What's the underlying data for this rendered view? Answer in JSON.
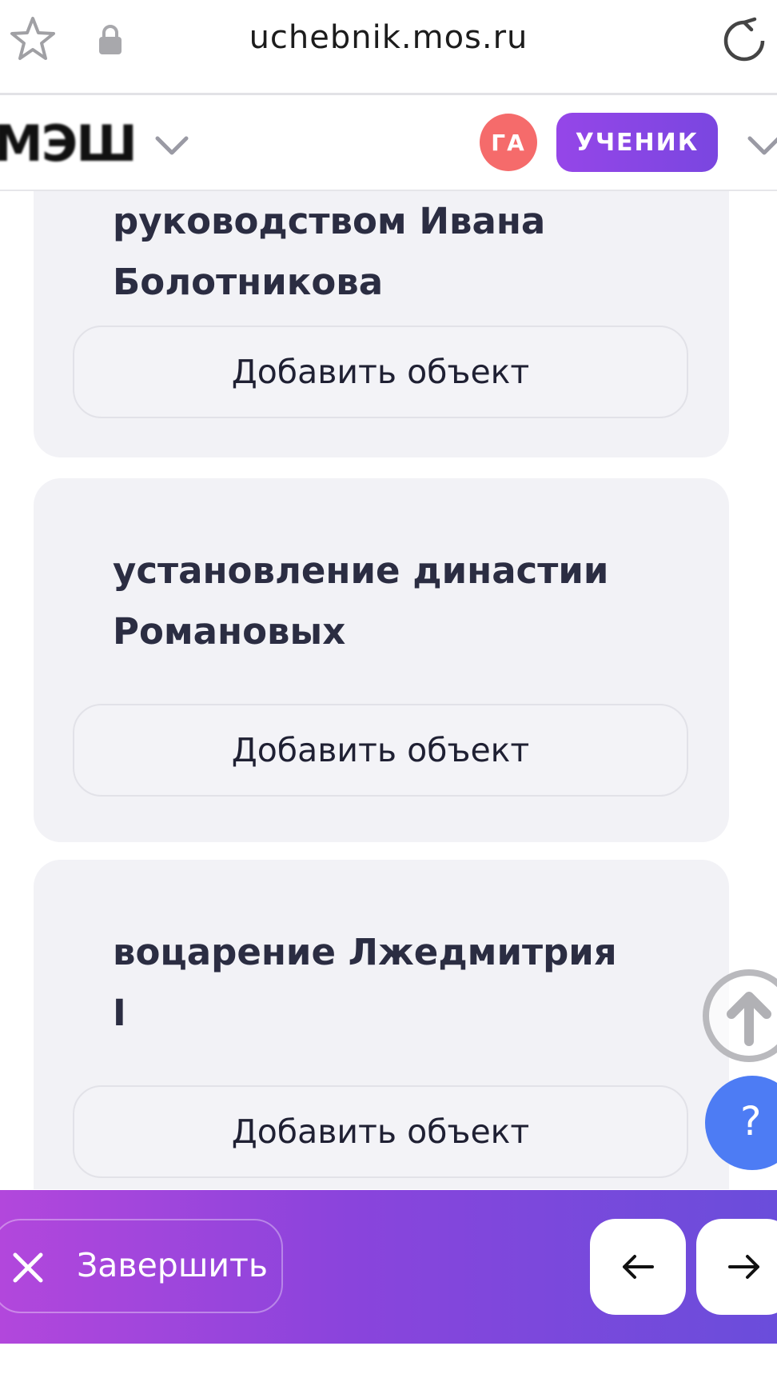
{
  "browser": {
    "url": "uchebnik.mos.ru",
    "icons": [
      "star-icon",
      "lock-icon",
      "reload-icon"
    ]
  },
  "header": {
    "logo": "МЭШ",
    "avatar_initials": "ГА",
    "role_label": "УЧЕНИК",
    "accent_color": "#8a46e6",
    "avatar_color": "#f56b6b"
  },
  "cards": [
    {
      "title_line1": "руководством Ивана",
      "title_line2": "Болотникова",
      "button": "Добавить объект"
    },
    {
      "title_line1": "установление династии",
      "title_line2": "Романовых",
      "button": "Добавить объект"
    },
    {
      "title_line1": "воцарение Лжедмитрия",
      "title_line2": "I",
      "button": "Добавить объект"
    }
  ],
  "floating": {
    "scroll_top_icon": "arrow-up-circle-icon",
    "help_label": "?",
    "help_color": "#4d7cf4"
  },
  "bottombar": {
    "finish_label": "Завершить",
    "prev_icon": "arrow-left-icon",
    "next_icon": "arrow-right-icon"
  }
}
